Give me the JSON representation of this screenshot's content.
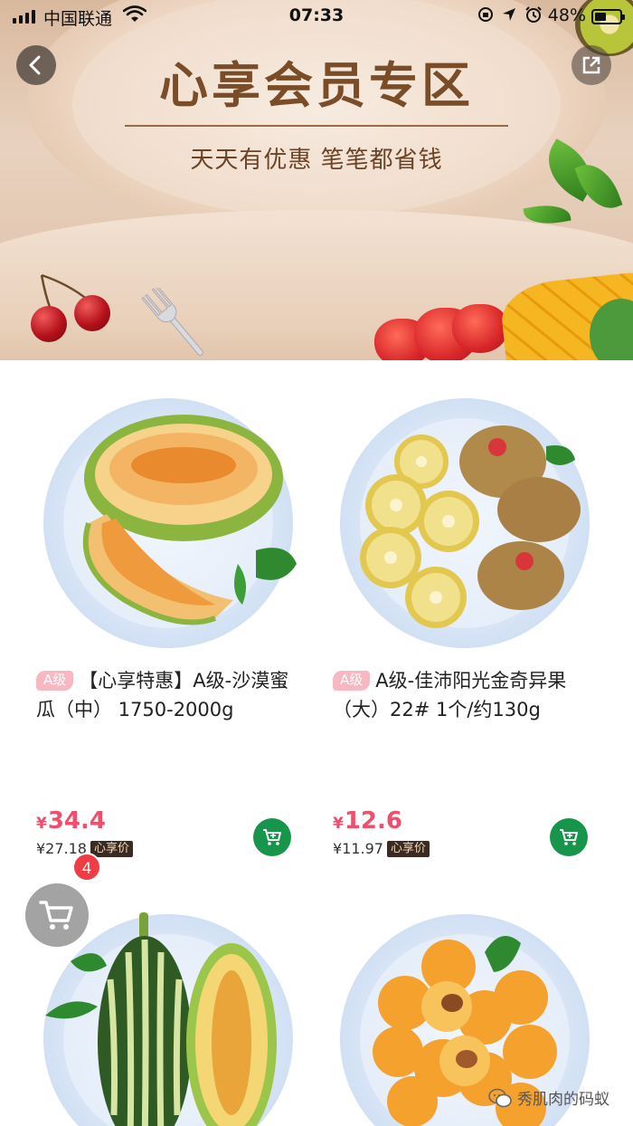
{
  "status_bar": {
    "carrier": "中国联通",
    "time": "07:33",
    "battery": "48%"
  },
  "banner": {
    "title": "心享会员专区",
    "subtitle": "天天有优惠 笔笔都省钱"
  },
  "products": [
    {
      "badge": "A级",
      "name": "【心享特惠】A级-沙漠蜜瓜（中） 1750-2000g",
      "price_symbol": "¥",
      "price": "34.4",
      "member_price": "¥27.18",
      "member_tag": "心享价",
      "image": "melon"
    },
    {
      "badge": "A级",
      "name": "A级-佳沛阳光金奇异果（大）22# 1个/约130g",
      "price_symbol": "¥",
      "price": "12.6",
      "member_price": "¥11.97",
      "member_tag": "心享价",
      "image": "golden-kiwi"
    },
    {
      "image": "striped-melon"
    },
    {
      "image": "loquat"
    }
  ],
  "cart": {
    "count": "4"
  },
  "watermark": {
    "text": "秀肌肉的码蚁"
  },
  "colors": {
    "price_pink": "#f04e6c",
    "cart_green": "#17964b",
    "badge_pink": "#f7b8c2",
    "cart_badge_red": "#ef3c45"
  }
}
